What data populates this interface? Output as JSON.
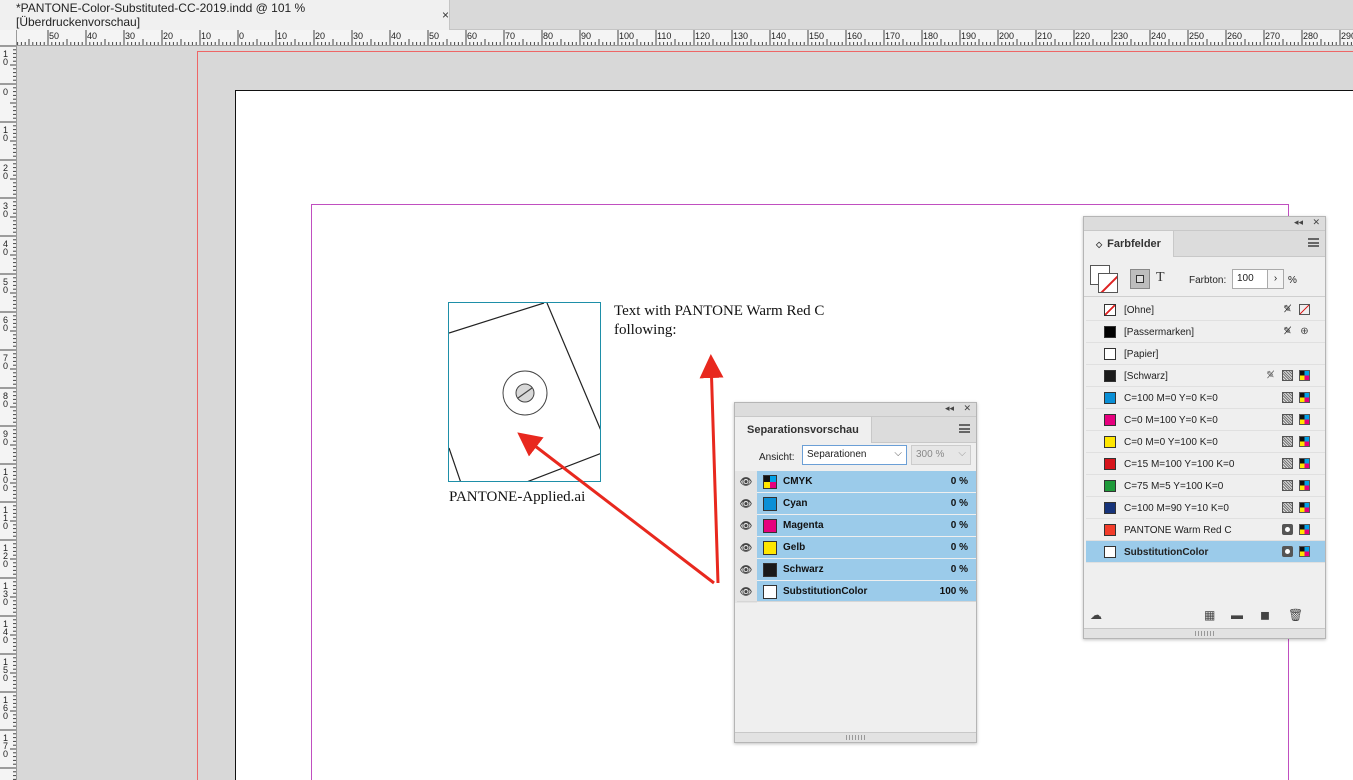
{
  "document_tab": {
    "title": "*PANTONE-Color-Substituted-CC-2019.indd @ 101 % [Überdruckenvorschau]",
    "close": "×"
  },
  "ruler_h": [
    "50",
    "40",
    "30",
    "20",
    "10",
    "0",
    "10",
    "20",
    "30",
    "40",
    "50",
    "60",
    "70",
    "80",
    "90",
    "100",
    "110",
    "120",
    "130",
    "140",
    "150",
    "160",
    "170",
    "180",
    "190",
    "200",
    "210",
    "220",
    "230",
    "240",
    "250",
    "260",
    "270",
    "280",
    "290"
  ],
  "ruler_v": [
    "1\n0",
    "0",
    "1\n0",
    "2\n0",
    "3\n0",
    "4\n0",
    "5\n0",
    "6\n0",
    "7\n0",
    "8\n0",
    "9\n0",
    "1\n0\n0",
    "1\n1\n0",
    "1\n2\n0",
    "1\n3\n0",
    "1\n4\n0",
    "1\n5\n0",
    "1\n6\n0",
    "1\n7\n0"
  ],
  "canvas": {
    "image_caption": "PANTONE-Applied.ai",
    "text_frame": "Text with PANTONE Warm Red C following:"
  },
  "separations": {
    "title": "Separationsvorschau",
    "view_label": "Ansicht:",
    "view_value": "Separationen",
    "zoom_value": "300 %",
    "rows": [
      {
        "name": "CMYK",
        "pct": "0 %",
        "swatch": "cmyk"
      },
      {
        "name": "Cyan",
        "pct": "0 %",
        "color": "#0a8fd6"
      },
      {
        "name": "Magenta",
        "pct": "0 %",
        "color": "#e6007e"
      },
      {
        "name": "Gelb",
        "pct": "0 %",
        "color": "#ffe600"
      },
      {
        "name": "Schwarz",
        "pct": "0 %",
        "color": "#1a1a1a"
      },
      {
        "name": "SubstitutionColor",
        "pct": "100 %",
        "color": "#ffffff"
      }
    ]
  },
  "swatches": {
    "title": "Farbfelder",
    "tint_label": "Farbton:",
    "tint_value": "100",
    "tint_unit": "%",
    "text_tool": "T",
    "rows": [
      {
        "label": "[Ohne]",
        "chip": "none",
        "icons": [
          "pencil-off-icon",
          "none-icon"
        ]
      },
      {
        "label": "[Passermarken]",
        "chip": "#000000",
        "icons": [
          "pencil-off-icon",
          "registration-icon"
        ]
      },
      {
        "label": "[Papier]",
        "chip": "#ffffff",
        "icons": []
      },
      {
        "label": "[Schwarz]",
        "chip": "#1a1a1a",
        "icons": [
          "pencil-off-icon",
          "process-icon",
          "cmyk-icon"
        ]
      },
      {
        "label": "C=100 M=0 Y=0 K=0",
        "chip": "#0a8fd6",
        "icons": [
          "process-icon",
          "cmyk-icon"
        ]
      },
      {
        "label": "C=0 M=100 Y=0 K=0",
        "chip": "#e6007e",
        "icons": [
          "process-icon",
          "cmyk-icon"
        ]
      },
      {
        "label": "C=0 M=0 Y=100 K=0",
        "chip": "#ffe600",
        "icons": [
          "process-icon",
          "cmyk-icon"
        ]
      },
      {
        "label": "C=15 M=100 Y=100 K=0",
        "chip": "#d6141c",
        "icons": [
          "process-icon",
          "cmyk-icon"
        ]
      },
      {
        "label": "C=75 M=5 Y=100 K=0",
        "chip": "#1f9a3a",
        "icons": [
          "process-icon",
          "cmyk-icon"
        ]
      },
      {
        "label": "C=100 M=90 Y=10 K=0",
        "chip": "#16337a",
        "icons": [
          "process-icon",
          "cmyk-icon"
        ]
      },
      {
        "label": "PANTONE Warm Red C",
        "chip": "#f23c2a",
        "icons": [
          "spot-icon",
          "cmyk-icon"
        ]
      },
      {
        "label": "SubstitutionColor",
        "chip": "#ffffff",
        "icons": [
          "spot-icon",
          "cmyk-icon"
        ],
        "selected": true
      }
    ]
  },
  "colors": {
    "selection": "#9bcbea",
    "arrow": "#e8281e",
    "frame": "#1e8fa8",
    "margin": "#c04fc0",
    "bleed": "#e66666"
  }
}
